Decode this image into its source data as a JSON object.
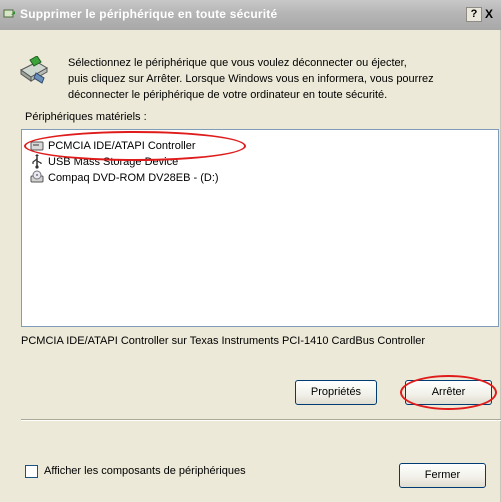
{
  "window": {
    "title": "Supprimer le périphérique en toute sécurité",
    "help_label": "?",
    "close_label": "X"
  },
  "intro": {
    "icon": "safely-remove-hardware-icon",
    "lines": [
      "Sélectionnez le périphérique que vous voulez déconnecter ou éjecter,",
      "puis cliquez sur Arrêter. Lorsque Windows vous en informera, vous pourrez",
      "déconnecter le périphérique de votre ordinateur en toute sécurité."
    ]
  },
  "devices": {
    "group_label": "Périphériques matériels :",
    "items": [
      {
        "label": "PCMCIA IDE/ATAPI Controller",
        "icon": "pcmcia-card-icon",
        "highlighted": true
      },
      {
        "label": "USB Mass Storage Device",
        "icon": "usb-icon",
        "highlighted": false
      },
      {
        "label": "Compaq DVD-ROM DV28EB - (D:)",
        "icon": "dvd-drive-icon",
        "highlighted": false
      }
    ]
  },
  "description": "PCMCIA IDE/ATAPI Controller sur Texas Instruments PCI-1410 CardBus Controller",
  "buttons": {
    "properties": "Propriétés",
    "stop": "Arrêter",
    "close": "Fermer"
  },
  "options": {
    "show_components_label": "Afficher les composants de périphériques",
    "show_components_checked": false
  },
  "colors": {
    "annotation": "#e01b1b",
    "titlebar": "#b6b5b5",
    "dialog_bg": "#ece9d8"
  }
}
